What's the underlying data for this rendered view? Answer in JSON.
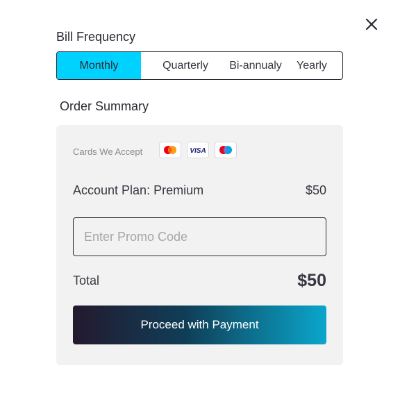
{
  "header": {
    "close_icon": "close-icon"
  },
  "bill_frequency": {
    "title": "Bill Frequency",
    "options": [
      {
        "label": "Monthly",
        "active": true
      },
      {
        "label": "Quarterly",
        "active": false
      },
      {
        "label": "Bi-annualy",
        "active": false
      },
      {
        "label": "Yearly",
        "active": false
      }
    ]
  },
  "order_summary": {
    "title": "Order Summary",
    "cards_label": "Cards We Accept",
    "cards": [
      {
        "icon": "mastercard-icon"
      },
      {
        "icon": "visa-icon",
        "text": "VISA"
      },
      {
        "icon": "maestro-icon"
      }
    ],
    "plan_label": "Account Plan: Premium",
    "plan_price": "$50",
    "promo_placeholder": "Enter Promo Code",
    "total_label": "Total",
    "total_value": "$50",
    "proceed_label": "Proceed with Payment"
  },
  "colors": {
    "accent": "#00d2ff",
    "card_bg": "#f2f2f2",
    "text": "#2d2933",
    "button_gradient_start": "#24192e",
    "button_gradient_end": "#0ba6cc"
  }
}
